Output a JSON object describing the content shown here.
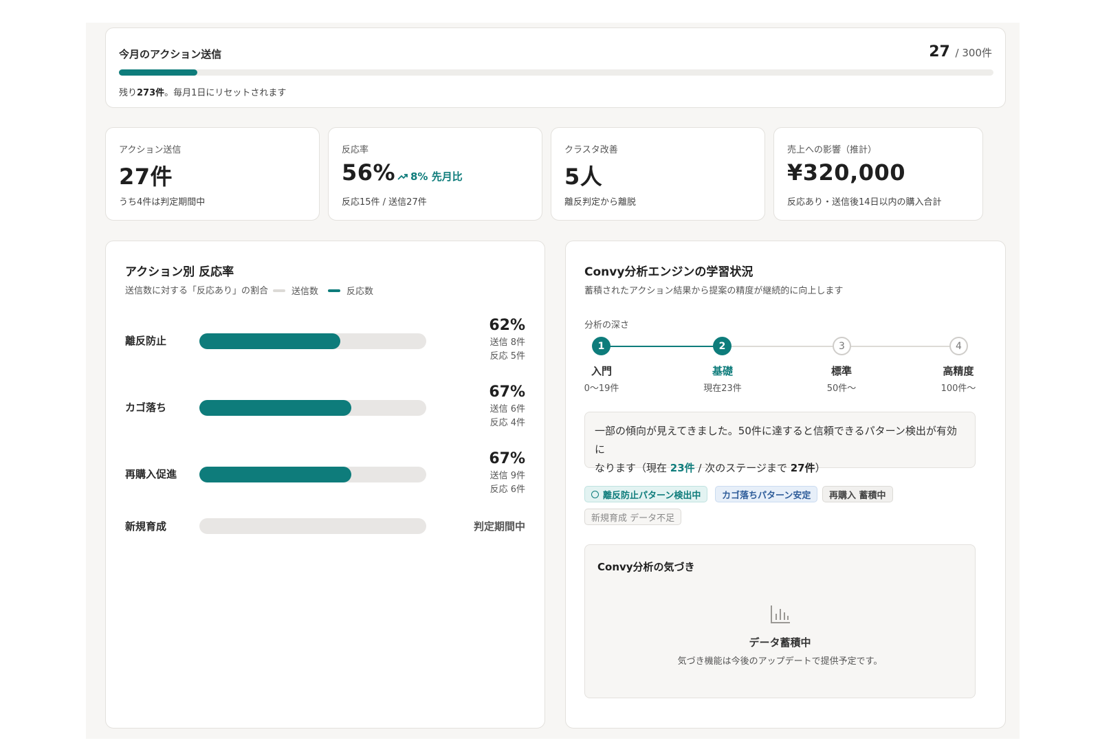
{
  "quota": {
    "title": "今月のアクション送信",
    "used": "27",
    "total_text": "/ 300件",
    "progress": 0.09,
    "note_prefix": "残り",
    "remaining": "273件",
    "note_suffix": "。毎月1日にリセットされます"
  },
  "kpis": [
    {
      "label": "アクション送信",
      "value": "27件",
      "sub": "うち4件は判定期間中"
    },
    {
      "label": "反応率",
      "value": "56%",
      "trend": "8% 先月比",
      "sub": "反応15件 / 送信27件"
    },
    {
      "label": "クラスタ改善",
      "value": "5人",
      "sub": "離反判定から離脱"
    },
    {
      "label": "売上への影響（推計）",
      "value": "¥320,000",
      "sub": "反応あり・送信後14日以内の購入合計"
    }
  ],
  "reaction": {
    "title": "アクション別 反応率",
    "subtitle": "送信数に対する「反応あり」の割合",
    "legend_sent": "送信数",
    "legend_reacted": "反応数",
    "rows": [
      {
        "label": "離反防止",
        "pct": "62%",
        "ratio": 0.62,
        "sent": "送信 8件",
        "reacted": "反応 5件"
      },
      {
        "label": "カゴ落ち",
        "pct": "67%",
        "ratio": 0.67,
        "sent": "送信 6件",
        "reacted": "反応 4件"
      },
      {
        "label": "再購入促進",
        "pct": "67%",
        "ratio": 0.67,
        "sent": "送信 9件",
        "reacted": "反応 6件"
      },
      {
        "label": "新規育成",
        "pending": "判定期間中",
        "ratio": 0
      }
    ]
  },
  "learning": {
    "title": "Convy分析エンジンの学習状況",
    "subtitle": "蓄積されたアクション結果から提案の精度が継続的に向上します",
    "depth_label": "分析の深さ",
    "steps": [
      {
        "num": "1",
        "name": "入門",
        "range": "0〜19件"
      },
      {
        "num": "2",
        "name": "基礎",
        "range": "現在23件"
      },
      {
        "num": "3",
        "name": "標準",
        "range": "50件〜"
      },
      {
        "num": "4",
        "name": "高精度",
        "range": "100件〜"
      }
    ],
    "message_line1": "一部の傾向が見えてきました。50件に達すると信頼できるパターン検出が有効に",
    "message_prefix": "なります（現在 ",
    "message_current": "23件",
    "message_mid": " / 次のステージまで ",
    "message_next": "27件",
    "message_end": "）",
    "tags": [
      {
        "label": "離反防止パターン検出中"
      },
      {
        "label": "カゴ落ちパターン安定"
      },
      {
        "label": "再購入 蓄積中"
      },
      {
        "label": "新規育成 データ不足"
      }
    ],
    "insight_title": "Convy分析の気づき",
    "insight_empty": "データ蓄積中",
    "insight_note": "気づき機能は今後のアップデートで提供予定です。"
  },
  "colors": {
    "accent": "#0e7c7b",
    "track": "#e8e6e4",
    "background": "#f7f6f4"
  }
}
